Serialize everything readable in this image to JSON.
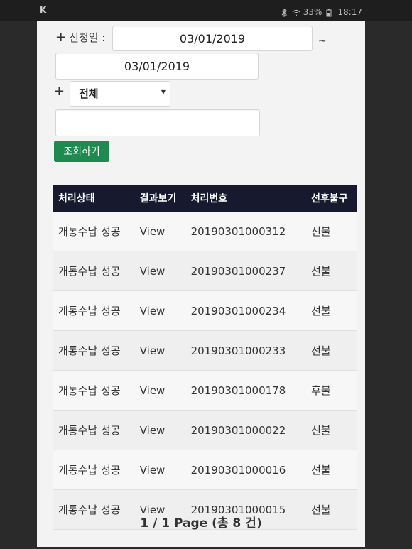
{
  "status_bar": {
    "app_icon_text": "K",
    "battery_text": "33%",
    "time": "18:17"
  },
  "filter": {
    "date_label": "신청일 :",
    "date_from": "03/01/2019",
    "date_to": "03/01/2019",
    "tilde": "~",
    "category_selected": "전체",
    "text_field_value": "",
    "search_button": "조회하기"
  },
  "table": {
    "headers": [
      "처리상태",
      "결과보기",
      "처리번호",
      "선후불구"
    ],
    "rows": [
      {
        "status": "개통수납 성공",
        "view": "View",
        "number": "20190301000312",
        "pay": "선불"
      },
      {
        "status": "개통수납 성공",
        "view": "View",
        "number": "20190301000237",
        "pay": "선불"
      },
      {
        "status": "개통수납 성공",
        "view": "View",
        "number": "20190301000234",
        "pay": "선불"
      },
      {
        "status": "개통수납 성공",
        "view": "View",
        "number": "20190301000233",
        "pay": "선불"
      },
      {
        "status": "개통수납 성공",
        "view": "View",
        "number": "20190301000178",
        "pay": "후불"
      },
      {
        "status": "개통수납 성공",
        "view": "View",
        "number": "20190301000022",
        "pay": "선불"
      },
      {
        "status": "개통수납 성공",
        "view": "View",
        "number": "20190301000016",
        "pay": "선불"
      },
      {
        "status": "개통수납 성공",
        "view": "View",
        "number": "20190301000015",
        "pay": "선불"
      }
    ]
  },
  "pager": {
    "text": "1 / 1 Page (총 8 건)"
  },
  "colors": {
    "header_bg": "#171a2e",
    "button_bg": "#1e8a4f"
  },
  "icons": [
    "bluetooth-icon",
    "wifi-icon",
    "battery-icon",
    "add-icon",
    "dropdown-chevron-icon"
  ]
}
